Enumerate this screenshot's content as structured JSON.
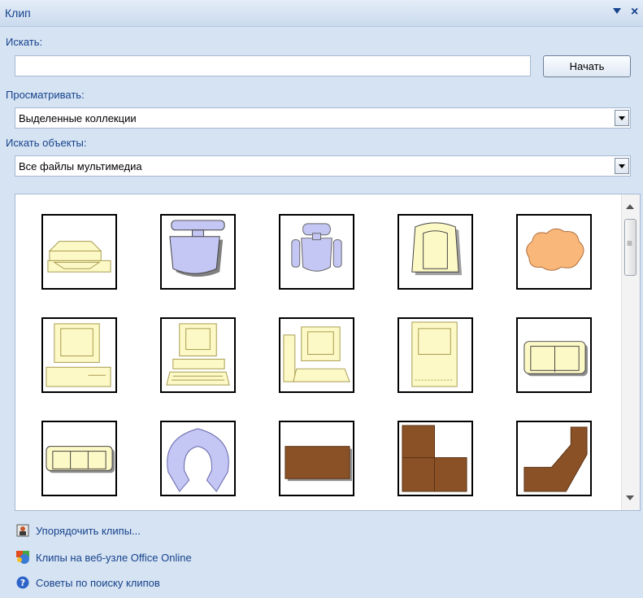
{
  "panel": {
    "title": "Клип"
  },
  "search": {
    "label": "Искать:",
    "value": "",
    "button": "Начать"
  },
  "browse": {
    "label": "Просматривать:",
    "value": "Выделенные коллекции"
  },
  "objects": {
    "label": "Искать объекты:",
    "value": "Все файлы мультимедиа"
  },
  "clips": [
    {
      "icon": "scanner-icon"
    },
    {
      "icon": "chair-top-icon"
    },
    {
      "icon": "office-chair-icon"
    },
    {
      "icon": "armchair-icon"
    },
    {
      "icon": "cloud-icon"
    },
    {
      "icon": "computer-desktop-icon"
    },
    {
      "icon": "computer-keyboard-icon"
    },
    {
      "icon": "computer-tower-icon"
    },
    {
      "icon": "mac-computer-icon"
    },
    {
      "icon": "loveseat-icon"
    },
    {
      "icon": "sofa-icon"
    },
    {
      "icon": "ring-shape-icon"
    },
    {
      "icon": "rectangle-table-icon"
    },
    {
      "icon": "l-desk-icon"
    },
    {
      "icon": "angled-desk-icon"
    }
  ],
  "links": {
    "organize": "Упорядочить клипы...",
    "online": "Клипы на веб-узле Office Online",
    "tips": "Советы по поиску клипов"
  },
  "colors": {
    "accent": "#15428b",
    "cream": "#fdf9c6",
    "lavender": "#c4c6f4",
    "brown": "#8b5126",
    "peach": "#f9b779"
  }
}
